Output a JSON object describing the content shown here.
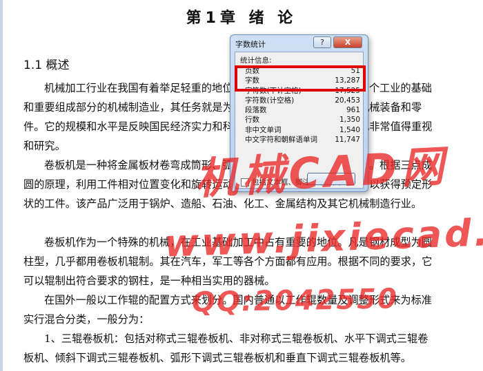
{
  "document": {
    "title": "第1章 绪  论",
    "section_heading": "1.1 概述",
    "paragraphs": [
      "机械加工行业在我国有着举足轻重的地位，是国民经济的支柱。作为整个工业的基础和重要组成部分的机械制造业，其任务就是为国民经济各行业提供先进的机械装备和零件。它的规模和水平是反映国民经济实力和科学技术水平的重要标志，因此非常值得重视和研究。",
      "卷板机是一种将金属板材卷弯成筒形、弧形或其他形状工件的通用设备。根据三点成圆的原理，利用工件相对位置变化和旋转运动使板材产生连续的塑性变形，以获得预定形状的工件。该产品广泛用于锅炉、造船、石油、化工、金属结构及其它机械制造行业。",
      "卷板机作为一个特殊的机械，在工业基础加工中占有重要的地位。凡是钢材成型为圆柱型，几乎都用卷板机辊制。其在汽车，军工等各个方面都有应用。根据不同的要求，它可以辊制出符合要求的钢柱，是一种相当实用的器械。",
      "在国外一般以工作辊的配置方式来划分。国内普通以工作辊数量及调整形式来为标准实行混合分类，一般分为：",
      "1、三辊卷板机：包括对称式三辊卷板机、非对称式三辊卷板机、水平下调式三辊卷板机、倾斜下调式三辊卷板机、弧形下调式三辊卷板机和垂直下调式三辊卷板机等。"
    ]
  },
  "dialog": {
    "title": "字数统计",
    "help_label": "?",
    "close_label": "X",
    "stats_header": "统计信息:",
    "stats": [
      {
        "label": "页数",
        "value": "51"
      },
      {
        "label": "字数",
        "value": "13,287"
      },
      {
        "label": "字符数(不计空格)",
        "value": "17,525"
      },
      {
        "label": "字符数(计空格)",
        "value": "20,453"
      },
      {
        "label": "段落数",
        "value": "961"
      },
      {
        "label": "行数",
        "value": "1,350"
      },
      {
        "label": "非中文单词",
        "value": "1,540"
      },
      {
        "label": "中文字符和朝鲜语单词",
        "value": "11,747"
      }
    ],
    "checkbox_label": "包括文本框、脚注和尾注(F)",
    "checkbox_checked": false
  },
  "watermark": {
    "line1": "机械CAD网",
    "line2": "www.jixiecad.com",
    "line3": "QQ:2042550"
  },
  "colors": {
    "highlight": "#e00000",
    "watermark": "#eb2828",
    "dialog_frame": "#b9d0ee"
  }
}
